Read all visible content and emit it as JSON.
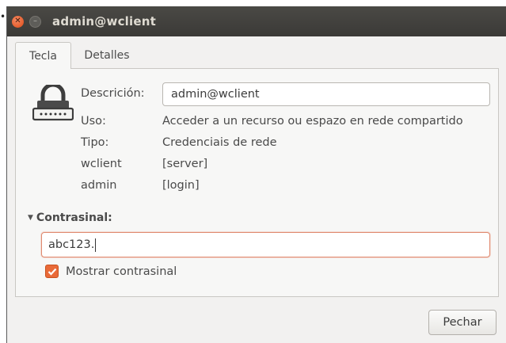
{
  "window": {
    "title": "admin@wclient"
  },
  "tabs": [
    {
      "label": "Tecla",
      "active": true
    },
    {
      "label": "Detalles",
      "active": false
    }
  ],
  "key": {
    "fields": [
      {
        "label": "Descrición:",
        "value": "admin@wclient"
      },
      {
        "label": "Uso:",
        "value": "Acceder a un recurso ou espazo en rede compartido"
      },
      {
        "label": "Tipo:",
        "value": "Credenciais de rede"
      },
      {
        "label": "wclient",
        "value": "[server]"
      },
      {
        "label": "admin",
        "value": "[login]"
      }
    ],
    "password_section_label": "Contrasinal:",
    "password_value": "abc123.",
    "show_password_label": "Mostrar contrasinal",
    "show_password_checked": true
  },
  "footer": {
    "close_label": "Pechar"
  },
  "colors": {
    "titlebar": "#3b3a37",
    "close_button": "#df4a16",
    "checkbox": "#e96a38",
    "focus_border": "#e08a70"
  },
  "icons": {
    "window_close": "close-icon",
    "window_minimize": "minimize-icon",
    "key_type": "padlock-icon",
    "expander": "triangle-down-icon",
    "checkbox_mark": "checkmark-icon"
  }
}
